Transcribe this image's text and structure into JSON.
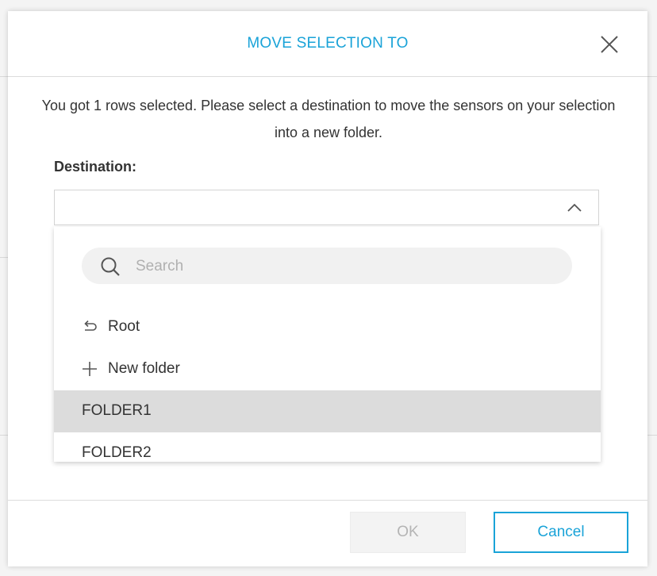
{
  "modal": {
    "title": "MOVE SELECTION TO",
    "message": "You got 1 rows selected. Please select a destination to move the sensors on your selection into a new folder.",
    "destination_label": "Destination:",
    "destination_value": "",
    "search_placeholder": "Search",
    "options": [
      {
        "label": "Root",
        "icon": "return-arrow-icon"
      },
      {
        "label": "New folder",
        "icon": "plus-icon"
      },
      {
        "label": "FOLDER1",
        "selected": true
      },
      {
        "label": "FOLDER2"
      }
    ],
    "ok_label": "OK",
    "cancel_label": "Cancel"
  },
  "colors": {
    "accent": "#1aa3d8",
    "selected_row": "#dcdcdc",
    "disabled_text": "#b4b4b4"
  }
}
